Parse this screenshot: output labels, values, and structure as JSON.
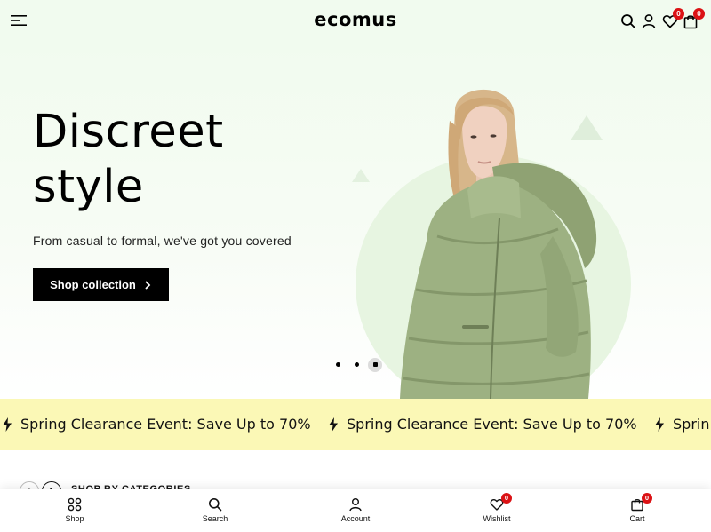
{
  "header": {
    "logo": "ecomus",
    "wishlist_count": "0",
    "cart_count": "0"
  },
  "hero": {
    "title_line1": "Discreet",
    "title_line2": "style",
    "subtitle": "From casual to formal, we've got you covered",
    "button_label": "Shop collection",
    "slide_total": 3,
    "slide_active": 3
  },
  "marquee": {
    "items": [
      "Spring Clearance Event: Save Up to 70%",
      "Spring Clearance Event: Save Up to 70%",
      "Sprin"
    ]
  },
  "categories": {
    "title": "SHOP BY CATEGORIES"
  },
  "toolbar": {
    "items": [
      {
        "label": "Shop",
        "icon": "grid-icon"
      },
      {
        "label": "Search",
        "icon": "search-icon"
      },
      {
        "label": "Account",
        "icon": "user-icon"
      },
      {
        "label": "Wishlist",
        "icon": "heart-icon",
        "badge": "0"
      },
      {
        "label": "Cart",
        "icon": "bag-icon",
        "badge": "0"
      }
    ]
  },
  "colors": {
    "hero_bg": "#f1fbef",
    "marquee_bg": "#fbf8b6",
    "badge": "#db1215",
    "button_bg": "#000000",
    "jacket": "#9aae7d"
  }
}
